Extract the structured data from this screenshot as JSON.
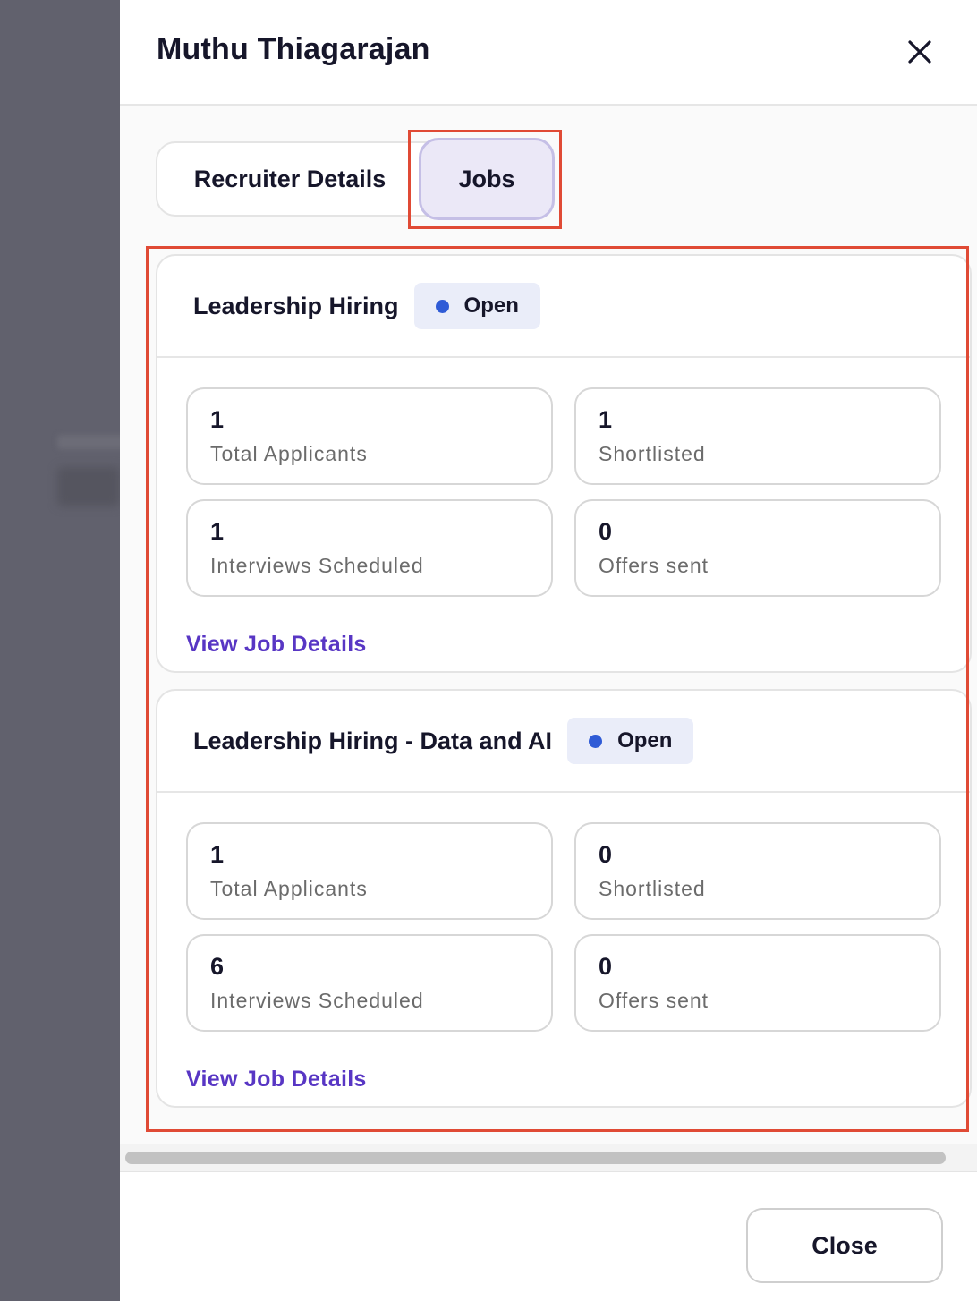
{
  "drawer": {
    "title": "Muthu Thiagarajan"
  },
  "tabs": [
    {
      "label": "Recruiter Details",
      "active": false
    },
    {
      "label": "Jobs",
      "active": true
    }
  ],
  "jobs": [
    {
      "title": "Leadership Hiring",
      "status": "Open",
      "stats": {
        "total_applicants": {
          "value": "1",
          "label": "Total Applicants"
        },
        "shortlisted": {
          "value": "1",
          "label": "Shortlisted"
        },
        "interviews_scheduled": {
          "value": "1",
          "label": "Interviews Scheduled"
        },
        "offers_sent": {
          "value": "0",
          "label": "Offers sent"
        }
      },
      "link": "View Job Details"
    },
    {
      "title": "Leadership Hiring - Data and AI",
      "status": "Open",
      "stats": {
        "total_applicants": {
          "value": "1",
          "label": "Total Applicants"
        },
        "shortlisted": {
          "value": "0",
          "label": "Shortlisted"
        },
        "interviews_scheduled": {
          "value": "6",
          "label": "Interviews Scheduled"
        },
        "offers_sent": {
          "value": "0",
          "label": "Offers sent"
        }
      },
      "link": "View Job Details"
    }
  ],
  "footer": {
    "close_label": "Close"
  },
  "colors": {
    "accent": "#5836c4",
    "status_dot": "#2f5bd6",
    "highlight": "#e04a35"
  },
  "icons": {
    "close": "close-icon",
    "status": "status-dot-icon"
  }
}
